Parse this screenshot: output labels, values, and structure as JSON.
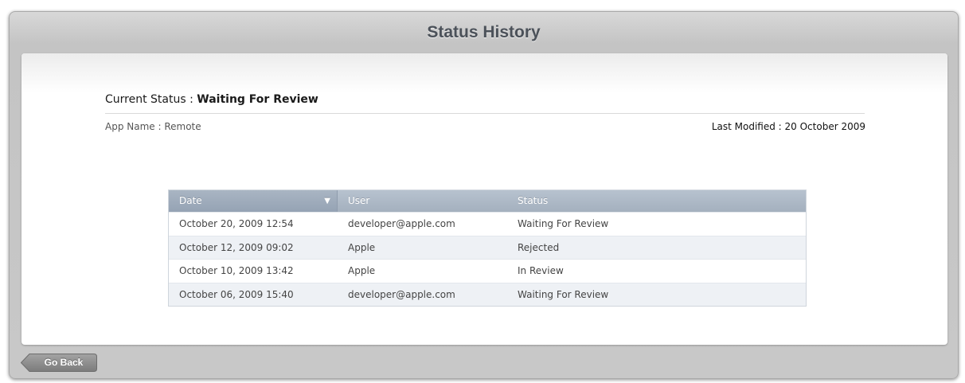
{
  "window": {
    "title": "Status History"
  },
  "status": {
    "label": "Current Status : ",
    "value": "Waiting For Review"
  },
  "app": {
    "name_label": "App Name : Remote"
  },
  "modified": {
    "label": "Last Modified : 20 October 2009"
  },
  "table": {
    "columns": [
      "Date",
      "User",
      "Status"
    ],
    "sort_column": "Date",
    "sort_direction": "descending",
    "rows": [
      [
        "October 20, 2009 12:54",
        "developer@apple.com",
        "Waiting For Review"
      ],
      [
        "October 12, 2009 09:02",
        "Apple",
        "Rejected"
      ],
      [
        "October 10, 2009 13:42",
        "Apple",
        "In Review"
      ],
      [
        "October 06, 2009 15:40",
        "developer@apple.com",
        "Waiting For Review"
      ]
    ]
  },
  "footer": {
    "back_label": "Go Back",
    "back_icon": "back-arrow-shape"
  },
  "colors": {
    "header_bar": "#c8c8c8",
    "title_text": "#4b5159",
    "table_header": "#a4b0be",
    "alt_row": "#eef1f5",
    "button": "#8a8a8a"
  }
}
